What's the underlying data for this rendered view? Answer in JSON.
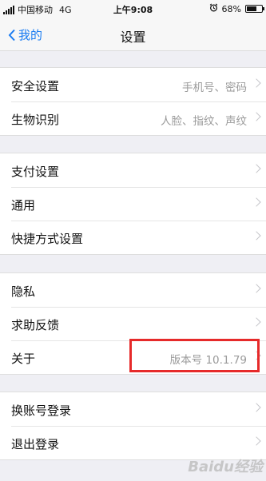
{
  "status_bar": {
    "carrier": "中国移动",
    "network": "4G",
    "time": "上午9:08",
    "battery": "68%",
    "battery_level": 0.68
  },
  "nav": {
    "back_label": "我的",
    "title": "设置"
  },
  "groups": [
    {
      "items": [
        {
          "label": "安全设置",
          "detail": "手机号、密码"
        },
        {
          "label": "生物识别",
          "detail": "人脸、指纹、声纹"
        }
      ]
    },
    {
      "items": [
        {
          "label": "支付设置"
        },
        {
          "label": "通用"
        },
        {
          "label": "快捷方式设置"
        }
      ]
    },
    {
      "items": [
        {
          "label": "隐私"
        },
        {
          "label": "求助反馈"
        },
        {
          "label": "关于",
          "detail": "版本号 10.1.79"
        }
      ]
    },
    {
      "items": [
        {
          "label": "换账号登录"
        },
        {
          "label": "退出登录"
        }
      ]
    }
  ],
  "highlight_color": "#e62a2a",
  "accent_color": "#1a7cf2",
  "watermark": "Baidu经验"
}
